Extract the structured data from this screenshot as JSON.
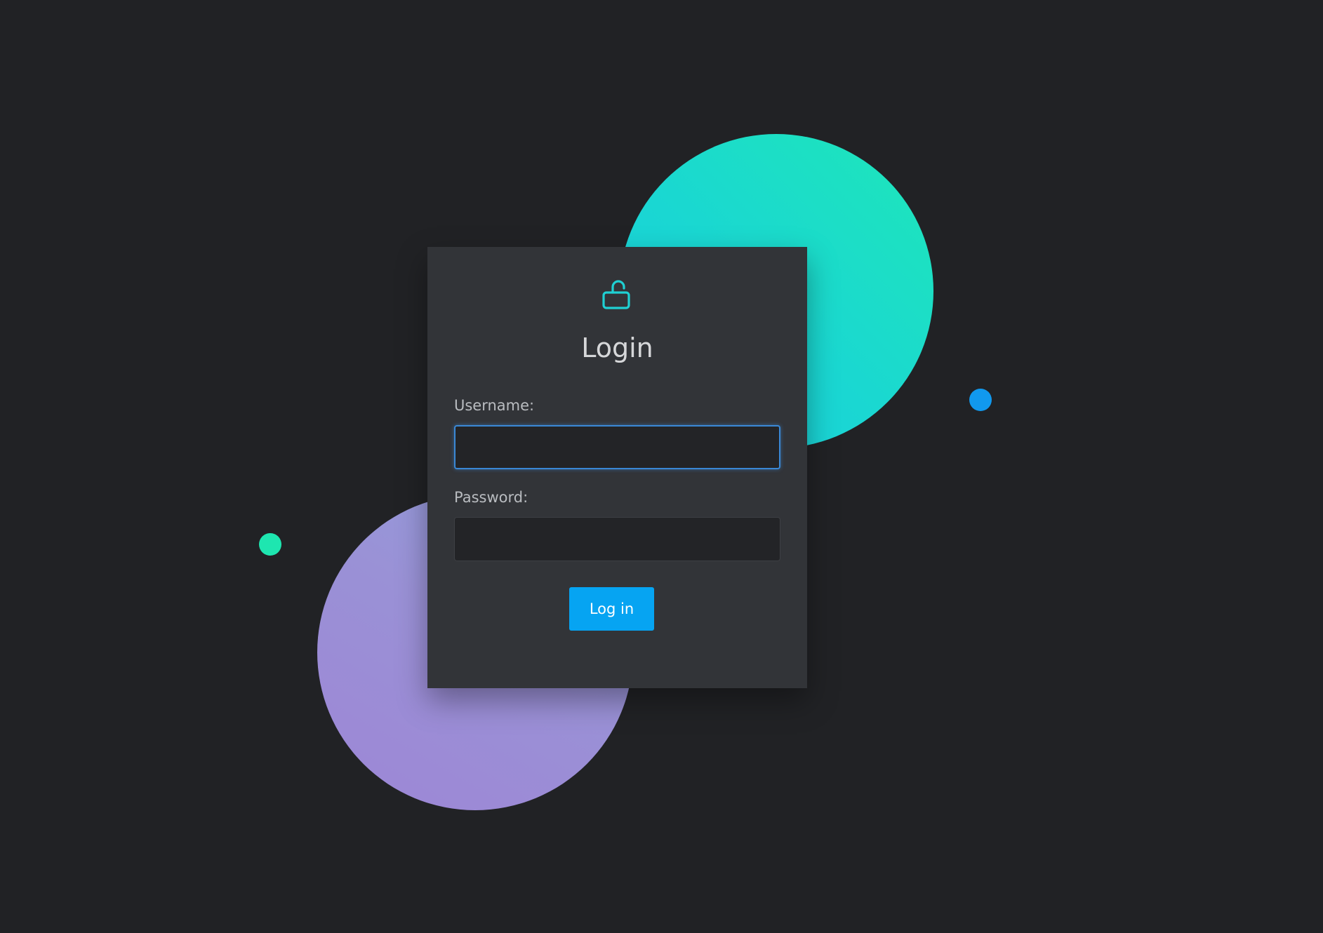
{
  "login": {
    "title": "Login",
    "username_label": "Username:",
    "username_value": "",
    "password_label": "Password:",
    "password_value": "",
    "submit_label": "Log in"
  },
  "icons": {
    "header_icon": "unlocked-padlock-icon"
  },
  "colors": {
    "background": "#212225",
    "card": "#323438",
    "accent_teal": "#1ad7d2",
    "accent_purple": "#9a91d6",
    "button": "#06a4f2",
    "focus_ring": "#3a88d6",
    "dot_blue": "#1199ee",
    "dot_green": "#1ee6b0"
  }
}
